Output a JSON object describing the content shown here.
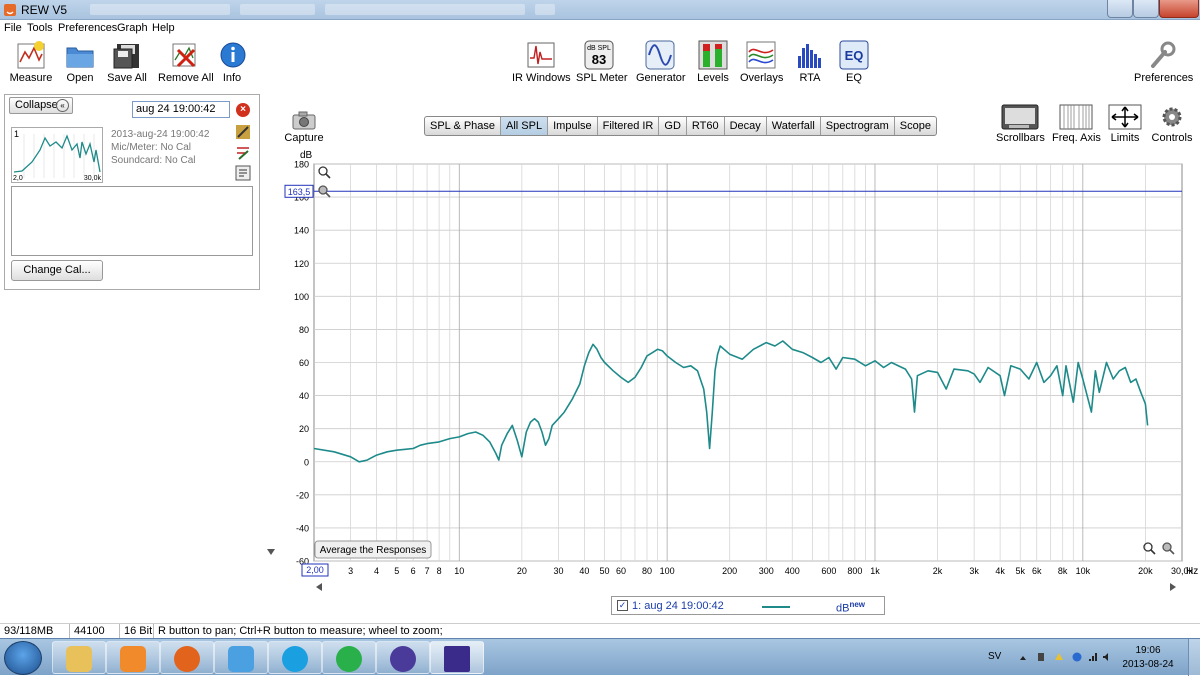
{
  "window": {
    "title": "REW V5"
  },
  "menu": [
    "File",
    "Tools",
    "Preferences",
    "Graph",
    "Help"
  ],
  "toolbar_left": [
    {
      "label": "Measure",
      "icon": "measure-icon"
    },
    {
      "label": "Open",
      "icon": "folder-icon"
    },
    {
      "label": "Save All",
      "icon": "floppy-icon"
    },
    {
      "label": "Remove All",
      "icon": "remove-icon"
    },
    {
      "label": "Info",
      "icon": "info-icon"
    }
  ],
  "toolbar_mid": [
    {
      "label": "IR Windows",
      "icon": "ir-windows-icon"
    },
    {
      "label": "SPL Meter",
      "icon": "spl-meter-icon",
      "meter_unit": "dB SPL",
      "meter_value": "83"
    },
    {
      "label": "Generator",
      "icon": "sine-wave-icon"
    },
    {
      "label": "Levels",
      "icon": "levels-icon"
    },
    {
      "label": "Overlays",
      "icon": "overlays-icon"
    },
    {
      "label": "RTA",
      "icon": "rta-icon"
    },
    {
      "label": "EQ",
      "icon": "eq-icon",
      "icon_text": "EQ"
    }
  ],
  "toolbar_right": {
    "label": "Preferences",
    "icon": "wrench-icon"
  },
  "left_panel": {
    "collapse_label": "Collapse",
    "measurement_name": "aug 24 19:00:42",
    "index": "1",
    "thumb_x_start": "2,0",
    "thumb_x_end": "30,0k",
    "date": "2013-aug-24 19:00:42",
    "mic": "Mic/Meter: No Cal",
    "soundcard": "Soundcard: No Cal",
    "change_cal_label": "Change Cal..."
  },
  "capture": {
    "label": "Capture",
    "icon": "camera-icon"
  },
  "graph_tabs": [
    {
      "label": "SPL & Phase",
      "selected": false
    },
    {
      "label": "All SPL",
      "selected": true
    },
    {
      "label": "Impulse",
      "selected": false
    },
    {
      "label": "Filtered IR",
      "selected": false
    },
    {
      "label": "GD",
      "selected": false
    },
    {
      "label": "RT60",
      "selected": false
    },
    {
      "label": "Decay",
      "selected": false
    },
    {
      "label": "Waterfall",
      "selected": false
    },
    {
      "label": "Spectrogram",
      "selected": false
    },
    {
      "label": "Scope",
      "selected": false
    }
  ],
  "graph_tools": [
    {
      "label": "Scrollbars",
      "icon": "scrollbars-icon"
    },
    {
      "label": "Freq. Axis",
      "icon": "freq-axis-icon"
    },
    {
      "label": "Limits",
      "icon": "limits-icon"
    },
    {
      "label": "Controls",
      "icon": "gear-icon"
    }
  ],
  "average_button_label": "Average the Responses",
  "legend": {
    "name": "1: aug 24 19:00:42",
    "unit": "dB",
    "unit_suffix": "new",
    "color": "#1e8a8a",
    "checked": true
  },
  "status": [
    "93/118MB",
    "44100 Hz",
    "16 Bit",
    "R button to pan; Ctrl+R button to measure; wheel to zoom;"
  ],
  "taskbar": {
    "apps": [
      {
        "name": "file-explorer-icon",
        "color": "#e8c15a"
      },
      {
        "name": "media-player-icon",
        "color": "#f08a2a"
      },
      {
        "name": "firefox-icon",
        "color": "#e2641c"
      },
      {
        "name": "messenger-icon",
        "color": "#4aa0e0"
      },
      {
        "name": "skype-icon",
        "color": "#1aa0e0"
      },
      {
        "name": "spotify-icon",
        "color": "#2ab04a"
      },
      {
        "name": "torrent-icon",
        "color": "#4a3a9a"
      },
      {
        "name": "rew-icon",
        "color": "#3a2a8a"
      }
    ],
    "language": "SV",
    "time": "19:06",
    "date": "2013-08-24"
  },
  "chart_data": {
    "type": "line",
    "xscale": "log",
    "ylabel": "dB",
    "xlabel": "Hz",
    "xlim": [
      2,
      30000
    ],
    "ylim": [
      -60,
      180
    ],
    "yticks": [
      -60,
      -40,
      -20,
      0,
      20,
      40,
      60,
      80,
      100,
      120,
      140,
      160,
      180
    ],
    "xticks": [
      {
        "v": 3,
        "label": "3"
      },
      {
        "v": 4,
        "label": "4"
      },
      {
        "v": 5,
        "label": "5"
      },
      {
        "v": 6,
        "label": "6"
      },
      {
        "v": 7,
        "label": "7"
      },
      {
        "v": 8,
        "label": "8"
      },
      {
        "v": 10,
        "label": "10"
      },
      {
        "v": 20,
        "label": "20"
      },
      {
        "v": 30,
        "label": "30"
      },
      {
        "v": 40,
        "label": "40"
      },
      {
        "v": 50,
        "label": "50"
      },
      {
        "v": 60,
        "label": "60"
      },
      {
        "v": 80,
        "label": "80"
      },
      {
        "v": 100,
        "label": "100"
      },
      {
        "v": 200,
        "label": "200"
      },
      {
        "v": 300,
        "label": "300"
      },
      {
        "v": 400,
        "label": "400"
      },
      {
        "v": 600,
        "label": "600"
      },
      {
        "v": 800,
        "label": "800"
      },
      {
        "v": 1000,
        "label": "1k"
      },
      {
        "v": 2000,
        "label": "2k"
      },
      {
        "v": 3000,
        "label": "3k"
      },
      {
        "v": 4000,
        "label": "4k"
      },
      {
        "v": 5000,
        "label": "5k"
      },
      {
        "v": 6000,
        "label": "6k"
      },
      {
        "v": 8000,
        "label": "8k"
      },
      {
        "v": 10000,
        "label": "10k"
      },
      {
        "v": 20000,
        "label": "20k"
      },
      {
        "v": 30000,
        "label": "30,0k"
      }
    ],
    "x_start_label": "2,00",
    "cursor": {
      "y": 163.5,
      "label": "163,5",
      "color": "#2233bb"
    },
    "series": [
      {
        "name": "1: aug 24 19:00:42",
        "color": "#1e8a8a",
        "points": [
          [
            2,
            8
          ],
          [
            2.5,
            6
          ],
          [
            3,
            3
          ],
          [
            3.3,
            0
          ],
          [
            3.6,
            1
          ],
          [
            4,
            4
          ],
          [
            4.5,
            6
          ],
          [
            5,
            7
          ],
          [
            5.5,
            7.5
          ],
          [
            6,
            8
          ],
          [
            6.5,
            10
          ],
          [
            7,
            11
          ],
          [
            8,
            12
          ],
          [
            9,
            14
          ],
          [
            10,
            15
          ],
          [
            11,
            17
          ],
          [
            12,
            18
          ],
          [
            13,
            16
          ],
          [
            14,
            12
          ],
          [
            15,
            5
          ],
          [
            15.5,
            1
          ],
          [
            16,
            10
          ],
          [
            17,
            17
          ],
          [
            18,
            22
          ],
          [
            19,
            13
          ],
          [
            20,
            3
          ],
          [
            21,
            18
          ],
          [
            22,
            24
          ],
          [
            23,
            26
          ],
          [
            24,
            24
          ],
          [
            25,
            18
          ],
          [
            26,
            10
          ],
          [
            27,
            14
          ],
          [
            28,
            22
          ],
          [
            30,
            26
          ],
          [
            32,
            30
          ],
          [
            35,
            38
          ],
          [
            38,
            47
          ],
          [
            40,
            58
          ],
          [
            42,
            66
          ],
          [
            44,
            71
          ],
          [
            46,
            68
          ],
          [
            48,
            63
          ],
          [
            50,
            60
          ],
          [
            55,
            55
          ],
          [
            60,
            51
          ],
          [
            65,
            48
          ],
          [
            70,
            51
          ],
          [
            75,
            57
          ],
          [
            80,
            64
          ],
          [
            85,
            66
          ],
          [
            90,
            68
          ],
          [
            95,
            67
          ],
          [
            100,
            64
          ],
          [
            110,
            60
          ],
          [
            120,
            57
          ],
          [
            130,
            58
          ],
          [
            140,
            55
          ],
          [
            150,
            44
          ],
          [
            155,
            30
          ],
          [
            160,
            8
          ],
          [
            165,
            30
          ],
          [
            170,
            55
          ],
          [
            175,
            65
          ],
          [
            180,
            70
          ],
          [
            200,
            65
          ],
          [
            230,
            62
          ],
          [
            260,
            68
          ],
          [
            300,
            72
          ],
          [
            330,
            70
          ],
          [
            360,
            73
          ],
          [
            400,
            68
          ],
          [
            450,
            66
          ],
          [
            500,
            63
          ],
          [
            550,
            60
          ],
          [
            600,
            63
          ],
          [
            650,
            56
          ],
          [
            700,
            63
          ],
          [
            800,
            62
          ],
          [
            900,
            58
          ],
          [
            1000,
            61
          ],
          [
            1100,
            57
          ],
          [
            1200,
            60
          ],
          [
            1400,
            56
          ],
          [
            1500,
            50
          ],
          [
            1550,
            30
          ],
          [
            1600,
            52
          ],
          [
            1800,
            55
          ],
          [
            2000,
            54
          ],
          [
            2200,
            44
          ],
          [
            2400,
            56
          ],
          [
            2800,
            55
          ],
          [
            3000,
            53
          ],
          [
            3200,
            48
          ],
          [
            3500,
            57
          ],
          [
            4000,
            52
          ],
          [
            4200,
            40
          ],
          [
            4500,
            58
          ],
          [
            5000,
            56
          ],
          [
            5500,
            50
          ],
          [
            6000,
            60
          ],
          [
            6500,
            48
          ],
          [
            7000,
            52
          ],
          [
            7500,
            58
          ],
          [
            8000,
            40
          ],
          [
            8300,
            58
          ],
          [
            9000,
            36
          ],
          [
            9500,
            60
          ],
          [
            10000,
            50
          ],
          [
            11000,
            30
          ],
          [
            11500,
            55
          ],
          [
            12000,
            42
          ],
          [
            13000,
            60
          ],
          [
            14000,
            50
          ],
          [
            15000,
            55
          ],
          [
            16000,
            57
          ],
          [
            17000,
            48
          ],
          [
            18000,
            50
          ],
          [
            19000,
            42
          ],
          [
            20000,
            35
          ],
          [
            20500,
            22
          ]
        ]
      }
    ]
  }
}
